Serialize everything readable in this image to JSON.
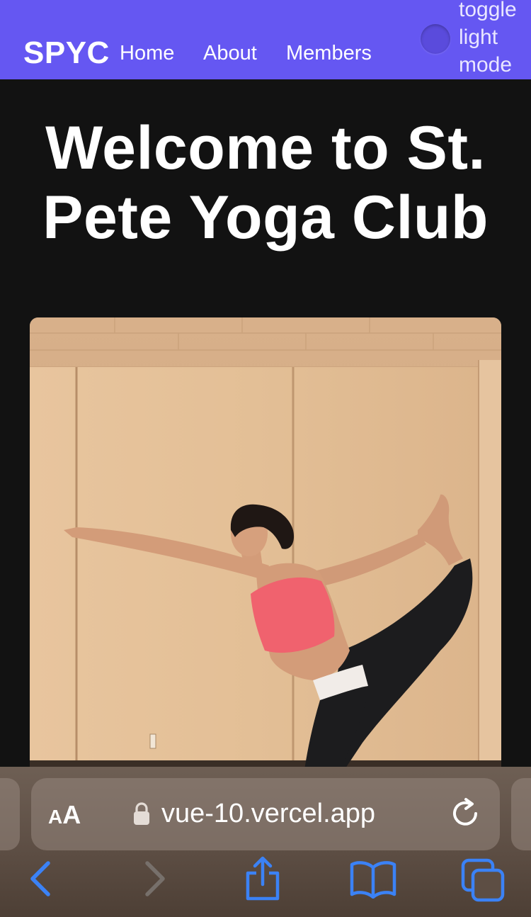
{
  "navbar": {
    "brand": "SPYC",
    "links": [
      {
        "label": "Home"
      },
      {
        "label": "About"
      },
      {
        "label": "Members"
      }
    ],
    "toggle_label": "toggle light mode",
    "colors": {
      "background": "#6557f2",
      "toggle": "#5a4bdc"
    }
  },
  "hero": {
    "title": "Welcome to St. Pete Yoga Club"
  },
  "photo": {
    "subject": "yoga-pose-photo"
  },
  "browser": {
    "aa_label_small": "A",
    "aa_label_large": "A",
    "url": "vue-10.vercel.app",
    "icons": [
      "lock-icon",
      "reload-icon",
      "back-icon",
      "forward-icon",
      "share-icon",
      "bookmarks-icon",
      "tabs-icon"
    ],
    "accent": "#3b82f6"
  }
}
